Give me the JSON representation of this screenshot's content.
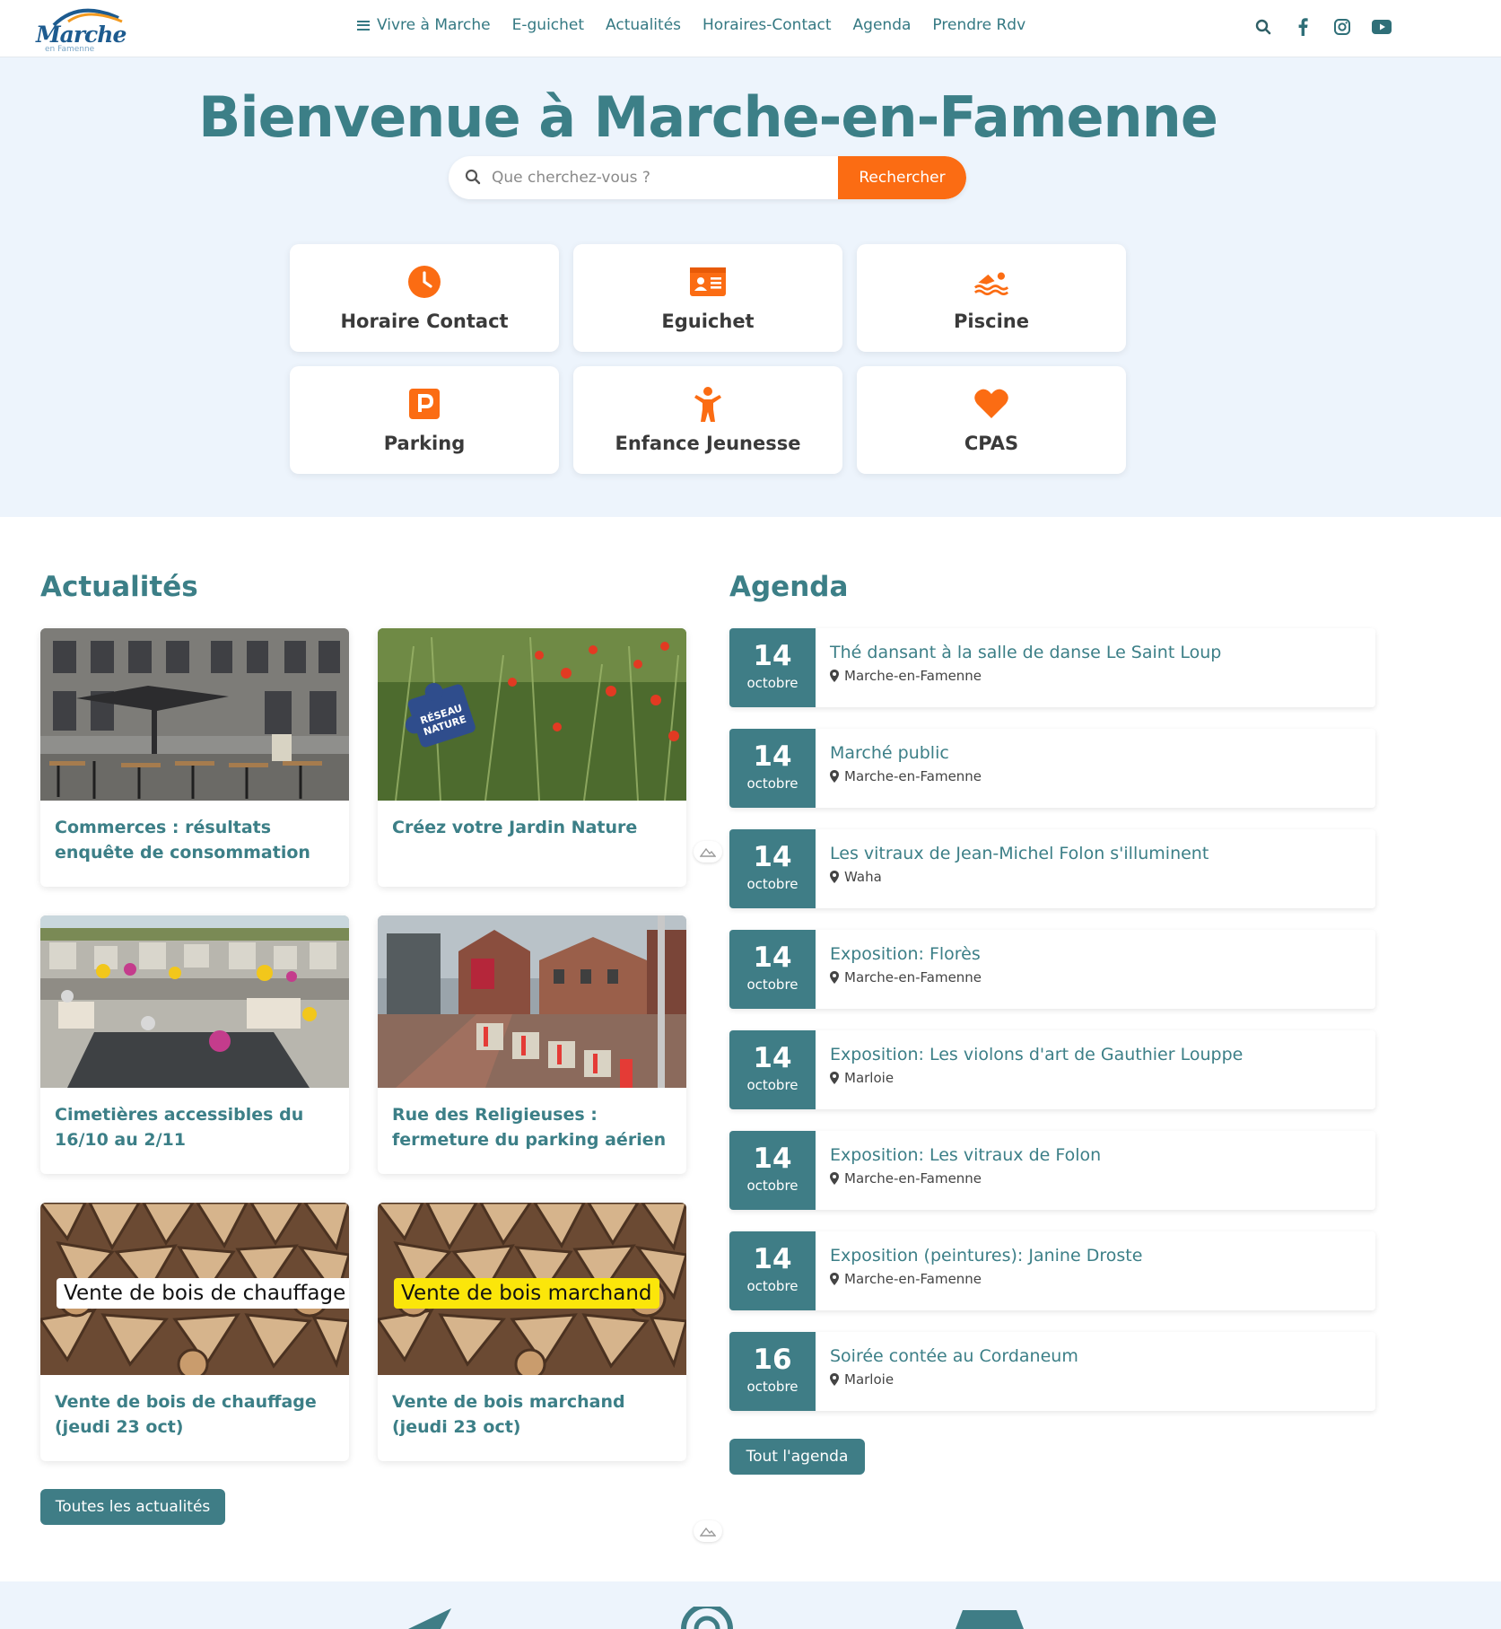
{
  "header": {
    "logo_text": "Marche",
    "logo_sub": "en Famenne",
    "nav": [
      {
        "label": "Vivre à Marche"
      },
      {
        "label": "E-guichet"
      },
      {
        "label": "Actualités"
      },
      {
        "label": "Horaires-Contact"
      },
      {
        "label": "Agenda"
      },
      {
        "label": "Prendre Rdv"
      }
    ],
    "social_icons": [
      "search-icon",
      "facebook-icon",
      "instagram-icon",
      "youtube-icon"
    ]
  },
  "hero": {
    "title": "Bienvenue à Marche-en-Famenne",
    "search_placeholder": "Que cherchez-vous ?",
    "search_button": "Rechercher",
    "tiles": [
      {
        "label": "Horaire Contact",
        "icon": "clock-icon"
      },
      {
        "label": "Eguichet",
        "icon": "id-card-icon"
      },
      {
        "label": "Piscine",
        "icon": "swimmer-icon"
      },
      {
        "label": "Parking",
        "icon": "parking-icon"
      },
      {
        "label": "Enfance Jeunesse",
        "icon": "child-icon"
      },
      {
        "label": "CPAS",
        "icon": "heart-icon"
      }
    ]
  },
  "news": {
    "title": "Actualités",
    "items": [
      {
        "title": "Commerces : résultats enquête de consommation",
        "image": "terrace-photo"
      },
      {
        "title": "Créez votre Jardin Nature",
        "image": "garden-photo"
      },
      {
        "title": "Cimetières accessibles du 16/10 au 2/11",
        "image": "cemetery-photo"
      },
      {
        "title": "Rue des Religieuses : fermeture du parking aérien",
        "image": "street-photo"
      },
      {
        "title": "Vente de bois de chauffage (jeudi 23 oct)",
        "image": "firewood-photo",
        "overlay": "Vente de bois de chauffage"
      },
      {
        "title": "Vente de bois marchand (jeudi 23 oct)",
        "image": "firewood-photo",
        "overlay": "Vente de bois marchand"
      }
    ],
    "button": "Toutes les actualités"
  },
  "agenda": {
    "title": "Agenda",
    "items": [
      {
        "day": "14",
        "month": "octobre",
        "title": "Thé dansant à la salle de danse Le Saint Loup",
        "place": "Marche-en-Famenne"
      },
      {
        "day": "14",
        "month": "octobre",
        "title": "Marché public",
        "place": "Marche-en-Famenne"
      },
      {
        "day": "14",
        "month": "octobre",
        "title": "Les vitraux de Jean-Michel Folon s'illuminent",
        "place": "Waha"
      },
      {
        "day": "14",
        "month": "octobre",
        "title": "Exposition: Florès",
        "place": "Marche-en-Famenne"
      },
      {
        "day": "14",
        "month": "octobre",
        "title": "Exposition: Les violons d'art de Gauthier Louppe",
        "place": "Marloie"
      },
      {
        "day": "14",
        "month": "octobre",
        "title": "Exposition: Les vitraux de Folon",
        "place": "Marche-en-Famenne"
      },
      {
        "day": "14",
        "month": "octobre",
        "title": "Exposition (peintures): Janine Droste",
        "place": "Marche-en-Famenne"
      },
      {
        "day": "16",
        "month": "octobre",
        "title": "Soirée contée au Cordaneum",
        "place": "Marloie"
      }
    ],
    "button": "Tout l'agenda"
  },
  "colors": {
    "accent": "#fb6c13",
    "teal": "#3f7d86",
    "hero_bg": "#edf4fc"
  }
}
